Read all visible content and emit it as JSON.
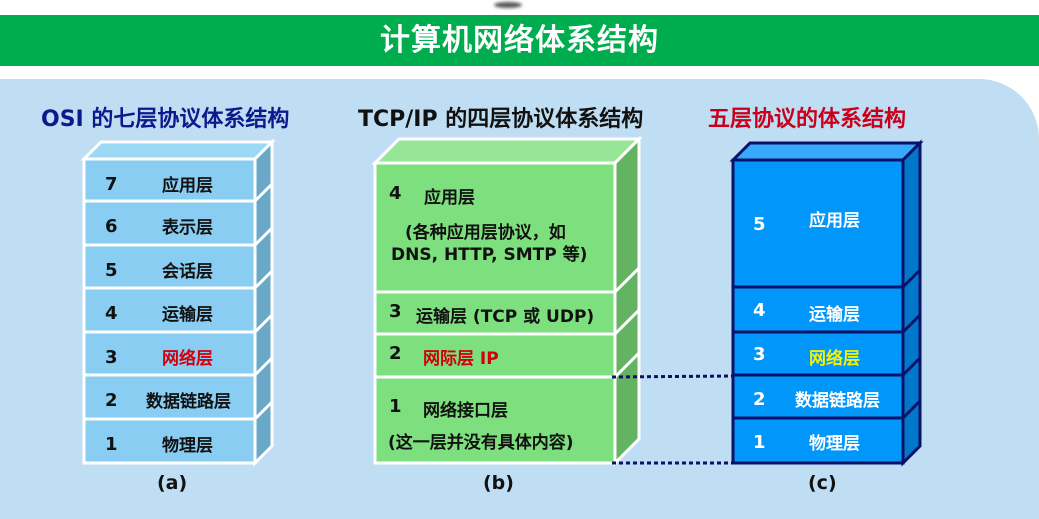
{
  "banner": {
    "title": "计算机网络体系结构"
  },
  "diagrams": {
    "osi": {
      "title": "OSI 的七层协议体系结构",
      "caption": "(a)",
      "layers": [
        {
          "num": "7",
          "name": "应用层"
        },
        {
          "num": "6",
          "name": "表示层"
        },
        {
          "num": "5",
          "name": "会话层"
        },
        {
          "num": "4",
          "name": "运输层"
        },
        {
          "num": "3",
          "name": "网络层",
          "highlight": "#d0000f"
        },
        {
          "num": "2",
          "name": "数据链路层"
        },
        {
          "num": "1",
          "name": "物理层"
        }
      ]
    },
    "tcpip": {
      "title": "TCP/IP 的四层协议体系结构",
      "caption": "(b)",
      "layers": [
        {
          "num": "4",
          "name": "应用层",
          "note_line1": "(各种应用层协议，如",
          "note_line2": "DNS, HTTP, SMTP 等)"
        },
        {
          "num": "3",
          "name": "运输层 (TCP 或 UDP)"
        },
        {
          "num": "2",
          "name": "网际层 IP",
          "highlight": "#d0000f"
        },
        {
          "num": "1",
          "name": "网络接口层",
          "note_line1": "(这一层并没有具体内容)"
        }
      ]
    },
    "five": {
      "title": "五层协议的体系结构",
      "caption": "(c)",
      "layers": [
        {
          "num": "5",
          "name": "应用层"
        },
        {
          "num": "4",
          "name": "运输层"
        },
        {
          "num": "3",
          "name": "网络层",
          "highlight": "#f4f000"
        },
        {
          "num": "2",
          "name": "数据链路层"
        },
        {
          "num": "1",
          "name": "物理层"
        }
      ]
    }
  },
  "colors": {
    "banner": "#00ad4e",
    "panel": "#bfdef3",
    "osi_front": "#89cdf3",
    "tcp_front": "#7ddf7d",
    "five_front": "#0096fa",
    "title_osi": "#0b1b8c",
    "title_five": "#c8001c"
  }
}
